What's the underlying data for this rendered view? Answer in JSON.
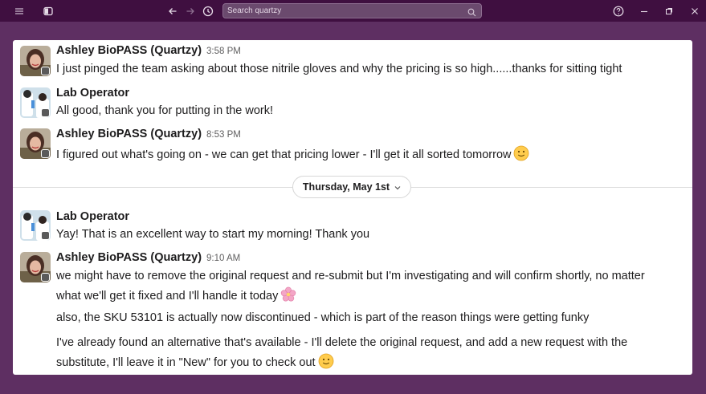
{
  "titlebar": {
    "search_placeholder": "Search quartzy",
    "icons": [
      "menu-icon",
      "sidebar-toggle-icon",
      "back-arrow-icon",
      "forward-arrow-icon",
      "history-icon",
      "search-icon",
      "help-icon",
      "minimize-icon",
      "restore-icon",
      "close-icon"
    ]
  },
  "messages": [
    {
      "author": "Ashley BioPASS (Quartzy)",
      "time": "3:58 PM",
      "lines": [
        "I just pinged the team asking about those nitrile gloves and why the pricing is so high......thanks for sitting tight"
      ]
    },
    {
      "author": "Lab Operator",
      "time": "",
      "lines": [
        "All good, thank you for putting in the work!"
      ]
    },
    {
      "author": "Ashley BioPASS (Quartzy)",
      "time": "8:53 PM",
      "lines": [
        "I figured out what's going on - we can get that pricing lower - I'll get it all sorted tomorrow"
      ],
      "emoji": "slightly-smiling-face"
    },
    {
      "author": "Lab Operator",
      "time": "",
      "lines": [
        "Yay! That is an excellent way to start my morning! Thank you"
      ]
    },
    {
      "author": "Ashley BioPASS (Quartzy)",
      "time": "9:10 AM",
      "lines": [
        "we might have to remove the original request and re-submit but I'm investigating and will confirm shortly, no matter",
        "what we'll get it fixed and I'll handle it today",
        "also, the SKU 53101 is actually now discontinued - which is part of the reason things were getting funky",
        "I've already found an alternative that's available  - I'll delete the original request, and add a new request with the",
        "substitute, I'll leave it in \"New\" for you to check out"
      ]
    }
  ],
  "divider": {
    "date": "Thursday, May 1st"
  },
  "colors": {
    "titlebar": "#3f0f40",
    "background": "#5e2f62",
    "panel": "#ffffff"
  }
}
